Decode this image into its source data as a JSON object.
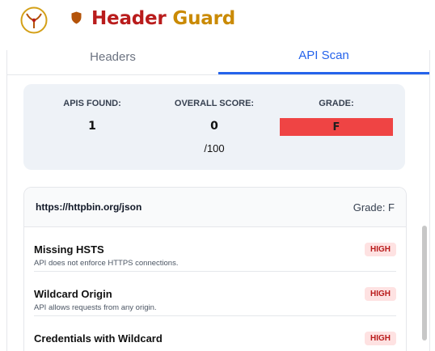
{
  "header": {
    "title_part1": "Header",
    "title_part2": "Guard",
    "logo_icon": "antenna-logo-icon",
    "shield_icon": "shield-icon"
  },
  "tabs": [
    {
      "label": "Headers",
      "active": false
    },
    {
      "label": "API Scan",
      "active": true
    }
  ],
  "summary": {
    "apis_found_label": "APIS FOUND:",
    "apis_found_value": "1",
    "score_label": "OVERALL SCORE:",
    "score_value": "0",
    "score_max": "/100",
    "grade_label": "GRADE:",
    "grade_value": "F"
  },
  "result": {
    "url": "https://httpbin.org/json",
    "grade_text": "Grade: F",
    "issues": [
      {
        "title": "Missing HSTS",
        "desc": "API does not enforce HTTPS connections.",
        "severity": "HIGH"
      },
      {
        "title": "Wildcard Origin",
        "desc": "API allows requests from any origin.",
        "severity": "HIGH"
      },
      {
        "title": "Credentials with Wildcard",
        "desc": "",
        "severity": "HIGH"
      }
    ]
  },
  "colors": {
    "brand_red": "#b91c1c",
    "brand_gold": "#ca8a04",
    "accent_blue": "#2563eb",
    "grade_f": "#ef4444"
  }
}
